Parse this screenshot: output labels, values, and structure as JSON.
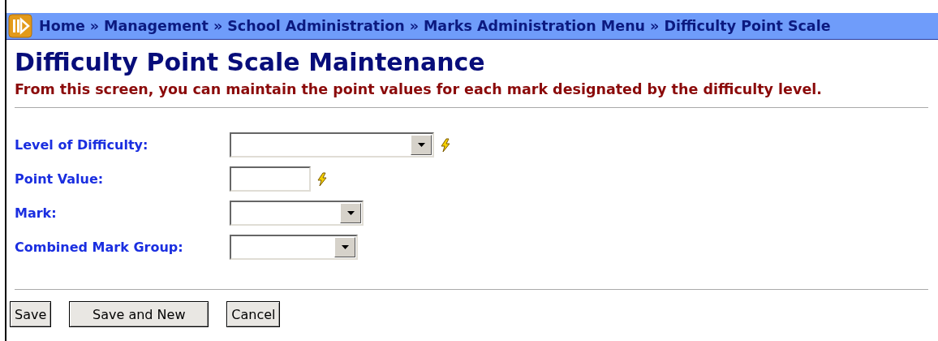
{
  "breadcrumb": [
    "Home",
    "Management",
    "School Administration",
    "Marks Administration Menu",
    "Difficulty Point Scale"
  ],
  "breadcrumb_separator": "»",
  "title": "Difficulty Point Scale Maintenance",
  "subtitle": "From this screen, you can maintain the point values for each mark designated by the difficulty level.",
  "fields": [
    {
      "label": "Level of Difficulty:",
      "kind": "select",
      "required": true
    },
    {
      "label": "Point Value:",
      "kind": "text",
      "required": true
    },
    {
      "label": "Mark:",
      "kind": "select",
      "required": false
    },
    {
      "label": "Combined Mark Group:",
      "kind": "select",
      "required": false
    }
  ],
  "buttons": [
    "Save",
    "Save and New",
    "Cancel"
  ]
}
